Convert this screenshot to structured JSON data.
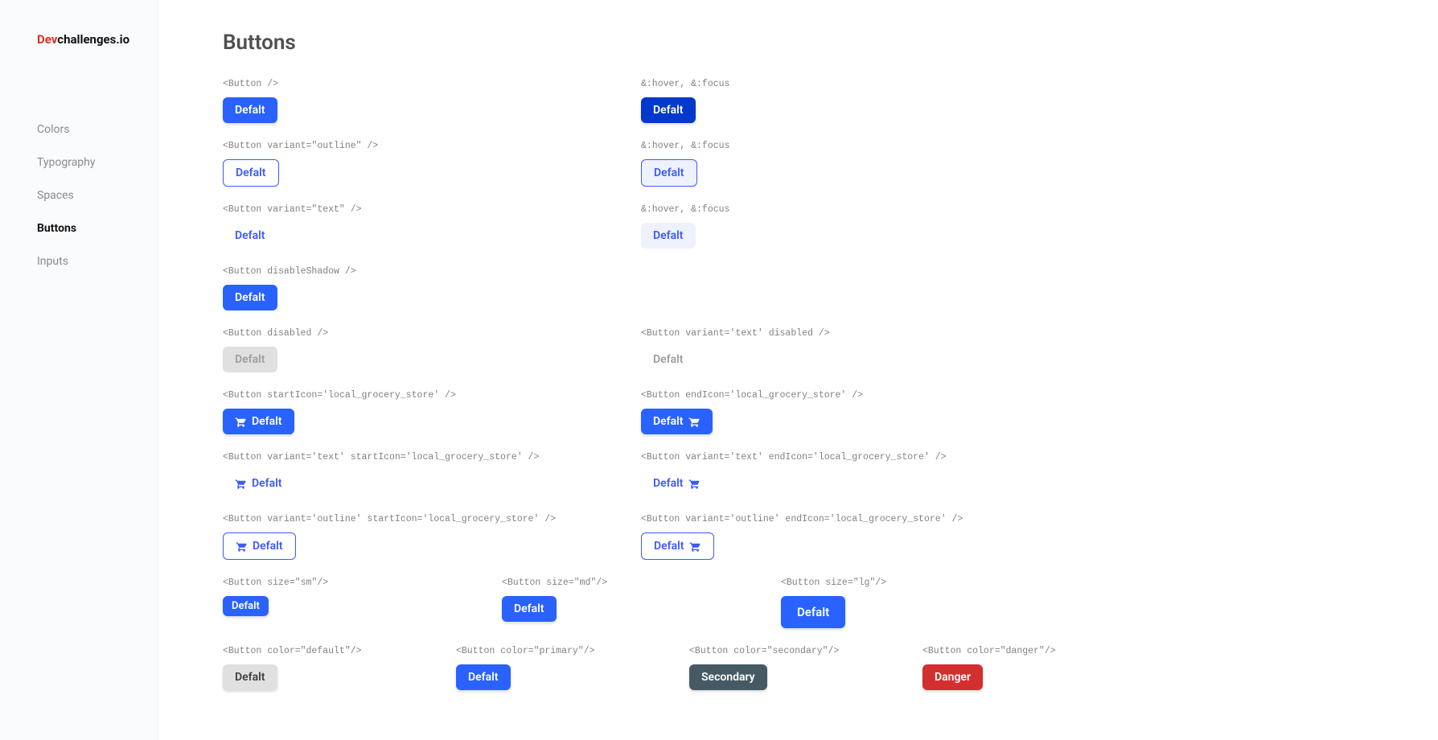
{
  "logo": {
    "dev": "Dev",
    "rest": "challenges.io"
  },
  "nav": [
    {
      "label": "Colors",
      "active": false
    },
    {
      "label": "Typography",
      "active": false
    },
    {
      "label": "Spaces",
      "active": false
    },
    {
      "label": "Buttons",
      "active": true
    },
    {
      "label": "Inputs",
      "active": false
    }
  ],
  "title": "Buttons",
  "defaultLabel": "Defalt",
  "secondaryLabel": "Secondary",
  "dangerLabel": "Danger",
  "captions": {
    "button": "<Button />",
    "hoverFocus": "&:hover, &:focus",
    "outline": "<Button variant=\"outline\" />",
    "text": "<Button variant=\"text\" />",
    "disableShadow": "<Button disableShadow />",
    "disabled": "<Button disabled />",
    "textDisabled": "<Button variant='text' disabled />",
    "startIcon": "<Button startIcon='local_grocery_store' />",
    "endIcon": "<Button endIcon='local_grocery_store' />",
    "textStartIcon": "<Button variant='text' startIcon='local_grocery_store' />",
    "textEndIcon": "<Button variant='text' endIcon='local_grocery_store' />",
    "outlineStartIcon": "<Button variant='outline' startIcon='local_grocery_store' />",
    "outlineEndIcon": "<Button variant='outline' endIcon='local_grocery_store' />",
    "sizeSm": "<Button size=\"sm\"/>",
    "sizeMd": "<Button size=\"md\"/>",
    "sizeLg": "<Button size=\"lg\"/>",
    "colorDefault": "<Button color=\"default\"/>",
    "colorPrimary": "<Button color=\"primary\"/>",
    "colorSecondary": "<Button color=\"secondary\"/>",
    "colorDanger": "<Button color=\"danger\"/>"
  }
}
